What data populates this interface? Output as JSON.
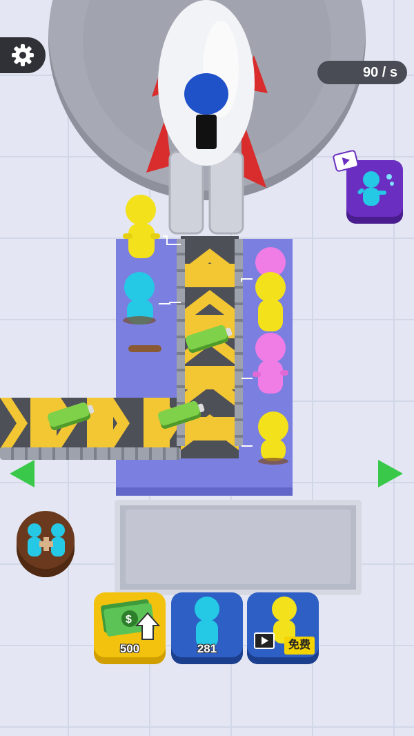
{
  "hud": {
    "rate_text": "90 / s",
    "settings_icon": "gear-icon"
  },
  "buttons": {
    "upgrade_money": {
      "icon": "cash-upgrade-icon",
      "value": "500"
    },
    "add_worker": {
      "icon": "worker-icon",
      "value": "281"
    },
    "free_worker": {
      "icon": "video-ad-icon",
      "label": "免费"
    }
  },
  "side": {
    "merge_icon": "merge-workers-icon",
    "ad_reward_icon": "tired-worker-video-icon",
    "left_arrow_icon": "arrow-left-icon",
    "right_arrow_icon": "arrow-right-icon"
  },
  "colors": {
    "worker_yellow": "#f3e11b",
    "worker_cyan": "#25c9e6",
    "worker_pink": "#f07ce6",
    "button_yellow": "#f2c20f",
    "button_blue": "#2d5fc4",
    "machine_purple": "#7a7fe0",
    "arrow_green": "#39c84a"
  }
}
